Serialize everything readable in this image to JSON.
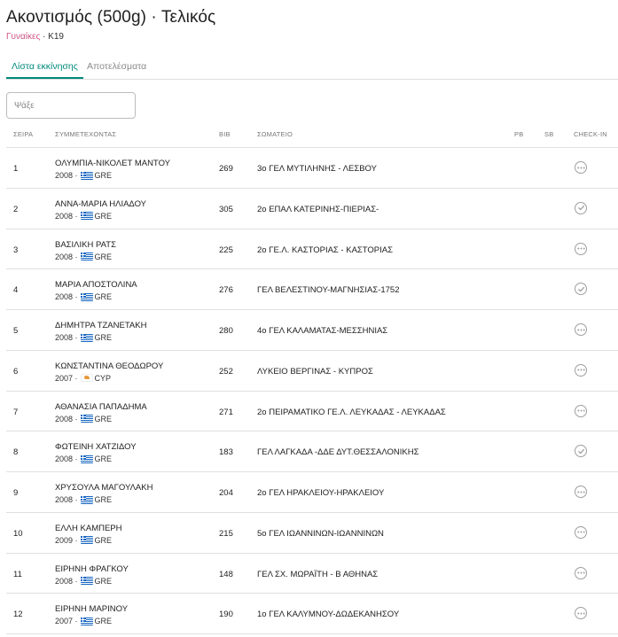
{
  "header": {
    "title": "Ακοντισμός (500g) · Τελικός",
    "category": "Γυναίκες",
    "separator": " · ",
    "age_group": "K19"
  },
  "tabs": [
    {
      "label": "Λίστα εκκίνησης",
      "active": true
    },
    {
      "label": "Αποτελέσματα",
      "active": false
    }
  ],
  "search": {
    "placeholder": "Ψάξε",
    "value": ""
  },
  "columns": {
    "order": "ΣΕΙΡΑ",
    "athlete": "ΣΥΜΜΕΤΕΧΟΝΤΑΣ",
    "bib": "BIB",
    "club": "ΣΩΜΑΤΕΙΟ",
    "pb": "PB",
    "sb": "SB",
    "checkin": "CHECK-IN"
  },
  "colors": {
    "accent": "#00897b",
    "category": "#c2185b"
  },
  "rows": [
    {
      "order": "1",
      "name": "ΟΛΥΜΠΙΑ-ΝΙΚΟΛΕΤ ΜΑΝΤΟΥ",
      "year": "2008",
      "country": "GRE",
      "bib": "269",
      "club": "3ο ΓΕΛ ΜΥΤΙΛΗΝΗΣ - ΛΕΣΒΟΥ",
      "checkin": "pending-icon"
    },
    {
      "order": "2",
      "name": "ΑΝΝΑ-ΜΑΡΙΑ ΗΛΙΑΔΟΥ",
      "year": "2008",
      "country": "GRE",
      "bib": "305",
      "club": "2ο ΕΠΑΛ ΚΑΤΕΡΙΝΗΣ-ΠΙΕΡΙΑΣ-",
      "checkin": "checked-icon"
    },
    {
      "order": "3",
      "name": "ΒΑΣΙΛΙΚΗ ΡΑΤΣ",
      "year": "2008",
      "country": "GRE",
      "bib": "225",
      "club": "2ο ΓΕ.Λ. ΚΑΣΤΟΡΙΑΣ - ΚΑΣΤΟΡΙΑΣ",
      "checkin": "pending-icon"
    },
    {
      "order": "4",
      "name": "ΜΑΡΙΑ ΑΠΟΣΤΟΛΙΝΑ",
      "year": "2008",
      "country": "GRE",
      "bib": "276",
      "club": "ΓΕΛ ΒΕΛΕΣΤΙΝΟΥ-ΜΑΓΝΗΣΙΑΣ-1752",
      "checkin": "checked-icon"
    },
    {
      "order": "5",
      "name": "ΔΗΜΗΤΡΑ ΤΖΑΝΕΤΑΚΗ",
      "year": "2008",
      "country": "GRE",
      "bib": "280",
      "club": "4ο ΓΕΛ ΚΑΛΑΜΑΤΑΣ-ΜΕΣΣΗΝΙΑΣ",
      "checkin": "pending-icon"
    },
    {
      "order": "6",
      "name": "ΚΩΝΣΤΑΝΤΙΝΑ ΘΕΟΔΩΡΟΥ",
      "year": "2007",
      "country": "CYP",
      "bib": "252",
      "club": "ΛΥΚΕΙΟ ΒΕΡΓΙΝΑΣ - ΚΥΠΡΟΣ",
      "checkin": "pending-icon"
    },
    {
      "order": "7",
      "name": "ΑΘΑΝΑΣΙΑ ΠΑΠΑΔΗΜΑ",
      "year": "2008",
      "country": "GRE",
      "bib": "271",
      "club": "2ο ΠΕΙΡΑΜΑΤΙΚΟ ΓΕ.Λ. ΛΕΥΚΑΔΑΣ - ΛΕΥΚΑΔΑΣ",
      "checkin": "pending-icon"
    },
    {
      "order": "8",
      "name": "ΦΩΤΕΙΝΗ ΧΑΤΖΙΔΟΥ",
      "year": "2008",
      "country": "GRE",
      "bib": "183",
      "club": "ΓΕΛ ΛΑΓΚΑΔΑ -ΔΔΕ ΔΥΤ.ΘΕΣΣΑΛΟΝΙΚΗΣ",
      "checkin": "checked-icon"
    },
    {
      "order": "9",
      "name": "ΧΡΥΣΟΥΛΑ ΜΑΓΟΥΛΑΚΗ",
      "year": "2008",
      "country": "GRE",
      "bib": "204",
      "club": "2ο ΓΕΛ ΗΡΑΚΛΕΙΟΥ-ΗΡΑΚΛΕΙΟΥ",
      "checkin": "pending-icon"
    },
    {
      "order": "10",
      "name": "ΕΛΛΗ ΚΑΜΠΕΡΗ",
      "year": "2009",
      "country": "GRE",
      "bib": "215",
      "club": "5ο ΓΕΛ ΙΩΑΝΝΙΝΩΝ-ΙΩΑΝΝΙΝΩΝ",
      "checkin": "pending-icon"
    },
    {
      "order": "11",
      "name": "ΕΙΡΗΝΗ ΦΡΑΓΚΟΥ",
      "year": "2008",
      "country": "GRE",
      "bib": "148",
      "club": "ΓΕΛ ΣΧ. ΜΩΡΑΪΤΗ - Β ΑΘΗΝΑΣ",
      "checkin": "pending-icon"
    },
    {
      "order": "12",
      "name": "ΕΙΡΗΝΗ ΜΑΡΙΝΟΥ",
      "year": "2007",
      "country": "GRE",
      "bib": "190",
      "club": "1ο ΓΕΛ ΚΑΛΥΜΝΟΥ-ΔΩΔΕΚΑΝΗΣΟΥ",
      "checkin": "pending-icon"
    }
  ]
}
